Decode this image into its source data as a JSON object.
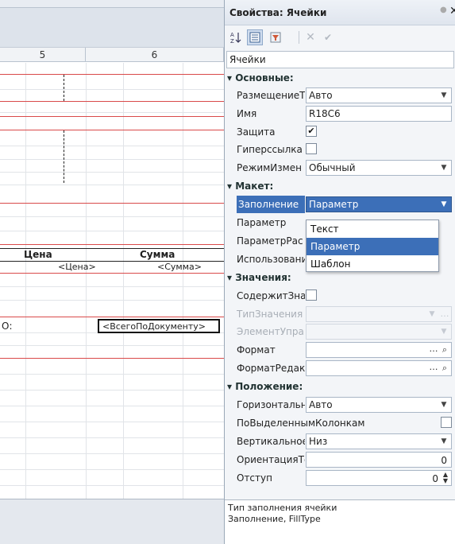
{
  "sheet": {
    "columns": [
      "5",
      "6"
    ],
    "headers": {
      "price": "Цена",
      "sum": "Сумма"
    },
    "params": {
      "price": "<Цена>",
      "sum": "<Сумма>"
    },
    "total_prefix": "О:",
    "total_param": "<ВсегоПоДокументу>"
  },
  "panel": {
    "title": "Свойства: Ячейки",
    "pin_icon": "pin-icon",
    "close_glyph": "✕",
    "object_selector": "Ячейки",
    "sections": {
      "basic": "Основные:",
      "layout": "Макет:",
      "values": "Значения:",
      "position": "Положение:"
    },
    "props": {
      "placement_label": "РазмещениеТ",
      "placement_value": "Авто",
      "name_label": "Имя",
      "name_value": "R18C6",
      "protect_label": "Защита",
      "hyperlink_label": "Гиперссылка",
      "editmode_label": "РежимИзмен",
      "editmode_value": "Обычный",
      "fill_label": "Заполнение",
      "fill_value": "Параметр",
      "param_label": "Параметр",
      "paramdecode_label": "ПараметрРас",
      "usage_label": "Использовани",
      "containsvalue_label": "СодержитЗна",
      "valuetype_label": "ТипЗначения",
      "control_label": "ЭлементУпра",
      "format_label": "Формат",
      "editformat_label": "ФорматРедак",
      "horizontal_label": "Горизонтальн",
      "horizontal_value": "Авто",
      "byselected_label": "ПоВыделенным",
      "byselected_suffix": "Колонкам",
      "vertical_label": "Вертикальное",
      "vertical_value": "Низ",
      "orientation_label": "ОриентацияТе",
      "orientation_value": "0",
      "indent_label": "Отступ",
      "indent_value": "0"
    },
    "dropdown_options": [
      "Текст",
      "Параметр",
      "Шаблон"
    ],
    "description": {
      "line1": "Тип заполнения ячейки",
      "line2": "Заполнение, FillType"
    },
    "accent_color": "#3c6fb8"
  }
}
